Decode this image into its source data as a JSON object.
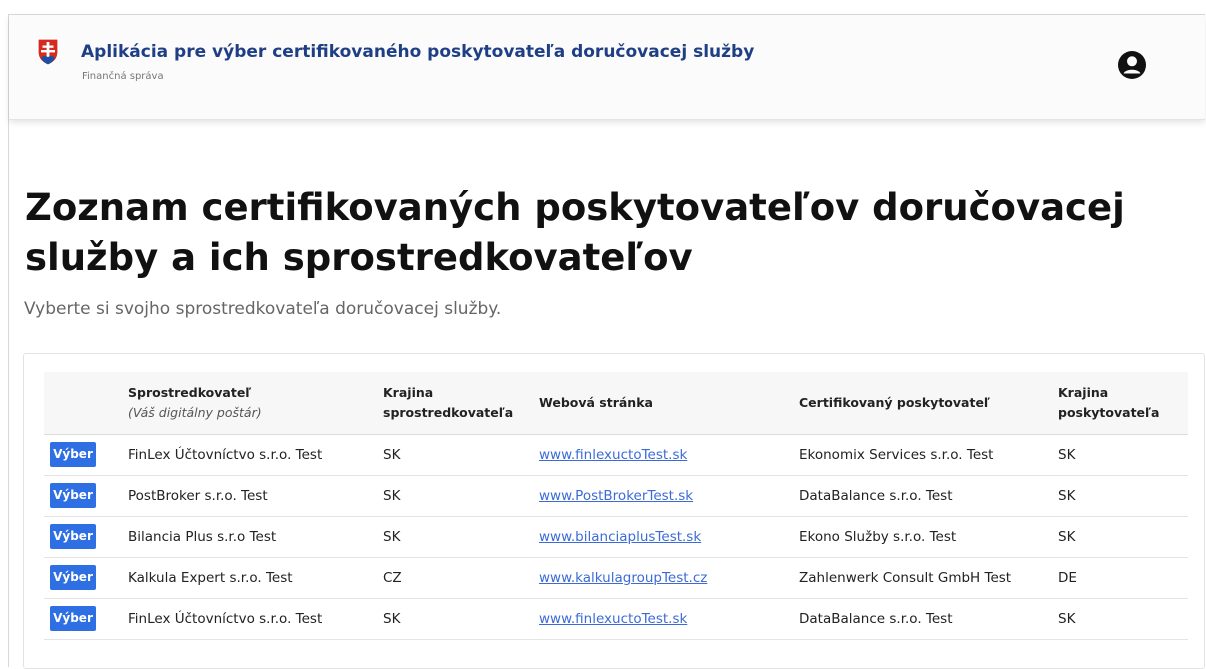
{
  "header": {
    "title": "Aplikácia pre výber certifikovaného poskytovateľa doručovacej služby",
    "subtitle": "Finančná správa"
  },
  "page": {
    "title": "Zoznam certifikovaných poskytovateľov doručovacej služby a ich sprostredkovateľov",
    "lead": "Vyberte si svojho sprostredkovateľa doručovacej služby."
  },
  "table": {
    "columns": {
      "intermediary": "Sprostredkovateľ",
      "intermediary_note": "(Váš digitálny poštár)",
      "intermediary_country": "Krajina sprostredkovateľa",
      "website": "Webová stránka",
      "provider": "Certifikovaný poskytovateľ",
      "provider_country": "Krajina poskytovateľa"
    },
    "select_label": "Výber",
    "rows": [
      {
        "intermediary": "FinLex Účtovníctvo s.r.o. Test",
        "intermediary_country": "SK",
        "website": "www.finlexuctoTest.sk",
        "provider": "Ekonomix Services s.r.o. Test",
        "provider_country": "SK"
      },
      {
        "intermediary": "PostBroker s.r.o. Test",
        "intermediary_country": "SK",
        "website": "www.PostBrokerTest.sk",
        "provider": "DataBalance s.r.o. Test",
        "provider_country": "SK"
      },
      {
        "intermediary": "Bilancia Plus s.r.o Test",
        "intermediary_country": "SK",
        "website": "www.bilanciaplusTest.sk",
        "provider": "Ekono Služby s.r.o. Test",
        "provider_country": "SK"
      },
      {
        "intermediary": "Kalkula Expert s.r.o. Test",
        "intermediary_country": "CZ",
        "website": "www.kalkulagroupTest.cz",
        "provider": "Zahlenwerk Consult GmbH Test",
        "provider_country": "DE"
      },
      {
        "intermediary": "FinLex Účtovníctvo s.r.o. Test",
        "intermediary_country": "SK",
        "website": "www.finlexuctoTest.sk",
        "provider": "DataBalance s.r.o. Test",
        "provider_country": "SK"
      }
    ]
  },
  "icons": {
    "crest": "slovak-coat-of-arms-icon",
    "user": "user-account-icon"
  },
  "colors": {
    "title_blue": "#1f3f85",
    "button_blue": "#2f6fe4",
    "link_blue": "#3c6bd8",
    "crest_red": "#d52b1e",
    "crest_blue": "#1e4fa0"
  }
}
